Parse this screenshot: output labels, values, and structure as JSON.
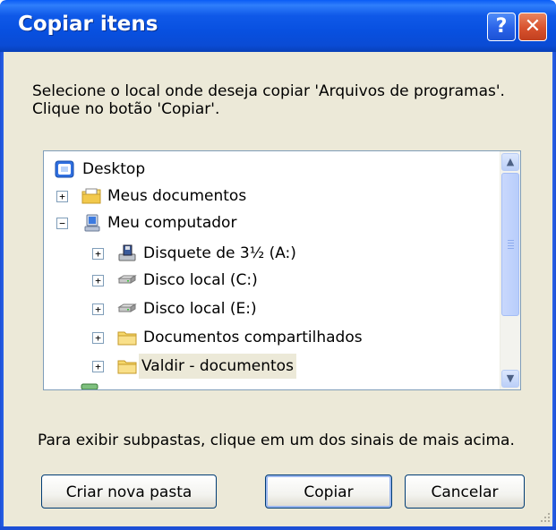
{
  "window": {
    "title": "Copiar itens",
    "help_label": "?",
    "close_label": "✕"
  },
  "instruction": "Selecione o local onde deseja copiar 'Arquivos de programas'. Clique no botão 'Copiar'.",
  "tree": {
    "items": [
      {
        "label": "Desktop",
        "icon": "desktop-icon",
        "expander": ""
      },
      {
        "label": "Meus documentos",
        "icon": "my-documents-icon",
        "expander": "+"
      },
      {
        "label": "Meu computador",
        "icon": "my-computer-icon",
        "expander": "−"
      },
      {
        "label": "Disquete de 3½ (A:)",
        "icon": "floppy-drive-icon",
        "expander": "+"
      },
      {
        "label": "Disco local (C:)",
        "icon": "hard-drive-icon",
        "expander": "+"
      },
      {
        "label": "Disco local (E:)",
        "icon": "hard-drive-icon",
        "expander": "+"
      },
      {
        "label": "Documentos compartilhados",
        "icon": "folder-icon",
        "expander": "+"
      },
      {
        "label": "Valdir - documentos",
        "icon": "folder-icon",
        "expander": "+",
        "selected": true
      }
    ]
  },
  "scrollbar": {
    "up_icon": "chevron-up-icon",
    "down_icon": "chevron-down-icon"
  },
  "hint": "Para exibir subpastas, clique em um dos sinais de mais acima.",
  "buttons": {
    "new_folder": "Criar nova pasta",
    "copy": "Copiar",
    "cancel": "Cancelar"
  },
  "colors": {
    "title_bar": "#0a50e0",
    "dialog_bg": "#ECE9D8",
    "close_button": "#d8522e",
    "selection": "#ece9d8"
  }
}
